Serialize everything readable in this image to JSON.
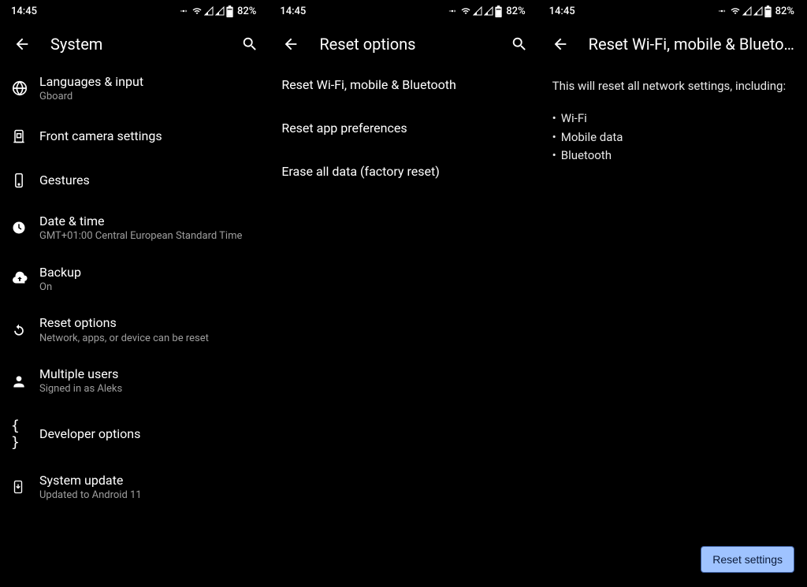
{
  "status": {
    "time": "14:45",
    "battery": "82%"
  },
  "screen1": {
    "title": "System",
    "items": [
      {
        "title": "Languages & input",
        "sub": "Gboard"
      },
      {
        "title": "Front camera settings",
        "sub": ""
      },
      {
        "title": "Gestures",
        "sub": ""
      },
      {
        "title": "Date & time",
        "sub": "GMT+01:00 Central European Standard Time"
      },
      {
        "title": "Backup",
        "sub": "On"
      },
      {
        "title": "Reset options",
        "sub": "Network, apps, or device can be reset"
      },
      {
        "title": "Multiple users",
        "sub": "Signed in as Aleks"
      },
      {
        "title": "Developer options",
        "sub": ""
      },
      {
        "title": "System update",
        "sub": "Updated to Android 11"
      }
    ]
  },
  "screen2": {
    "title": "Reset options",
    "items": [
      "Reset Wi-Fi, mobile & Bluetooth",
      "Reset app preferences",
      "Erase all data (factory reset)"
    ]
  },
  "screen3": {
    "title": "Reset Wi-Fi, mobile & Blueto…",
    "body": "This will reset all network settings, including:",
    "bullets": [
      "Wi-Fi",
      "Mobile data",
      "Bluetooth"
    ],
    "button": "Reset settings"
  }
}
